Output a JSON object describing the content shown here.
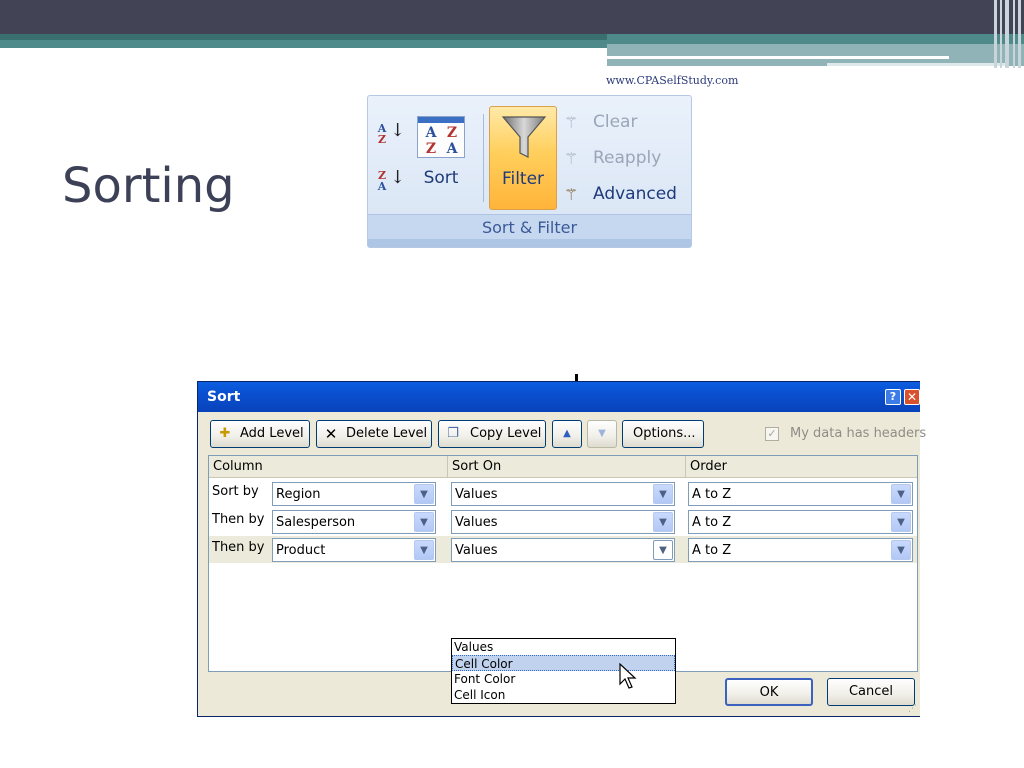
{
  "slide": {
    "url": "www.CPASelfStudy.com",
    "title": "Sorting"
  },
  "ribbon": {
    "group_label": "Sort & Filter",
    "sort_az_letters": [
      "A",
      "Z"
    ],
    "sort_za_letters": [
      "Z",
      "A"
    ],
    "sort_icon_letters": [
      "A",
      "Z",
      "Z",
      "A"
    ],
    "sort_label": "Sort",
    "filter_label": "Filter",
    "clear_label": "Clear",
    "reapply_label": "Reapply",
    "advanced_label": "Advanced",
    "colors": {
      "filter_active": "#ffc94d",
      "label_text": "#1e3a7a",
      "disabled_text": "#9aa6b8"
    }
  },
  "dialog": {
    "title": "Sort",
    "help_glyph": "?",
    "close_glyph": "✕",
    "toolbar": {
      "add_level": "Add Level",
      "delete_level": "Delete Level",
      "copy_level": "Copy Level",
      "move_up_glyph": "▲",
      "move_down_glyph": "▼",
      "options": "Options..."
    },
    "my_data_has_headers": {
      "label": "My data has headers",
      "checked": true,
      "check_glyph": "✓"
    },
    "columns": [
      "Column",
      "Sort On",
      "Order"
    ],
    "levels": [
      {
        "label": "Sort by",
        "column": "Region",
        "sort_on": "Values",
        "order": "A to Z",
        "selected": false
      },
      {
        "label": "Then by",
        "column": "Salesperson",
        "sort_on": "Values",
        "order": "A to Z",
        "selected": false
      },
      {
        "label": "Then by",
        "column": "Product",
        "sort_on": "Values",
        "order": "A to Z",
        "selected": true
      }
    ],
    "sort_on_dropdown": {
      "options": [
        "Values",
        "Cell Color",
        "Font Color",
        "Cell Icon"
      ],
      "highlighted_index": 1
    },
    "ok_label": "OK",
    "cancel_label": "Cancel",
    "combo_arrow_glyph": "▼",
    "colors": {
      "titlebar": "#0a4fd0",
      "dialog_bg": "#ece9d8",
      "highlight": "#c1d2ee"
    }
  }
}
